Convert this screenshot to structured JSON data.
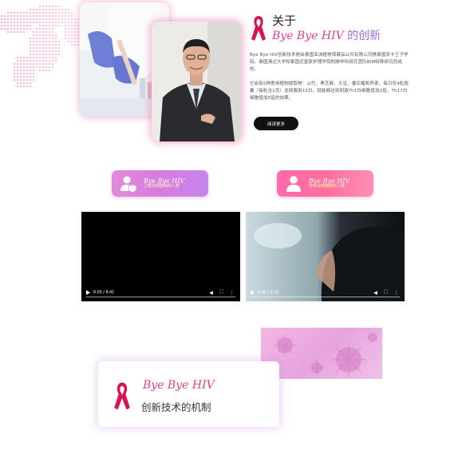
{
  "about": {
    "title_prefix": "关于",
    "brand": "Bye Bye HIV",
    "title_suffix": "的创新",
    "paragraph1": "Bye Bye HIV创新技术是由泰国亚洲植物保健品公共有限公司携泰国宋卡王子学院、泰国清迈大学和泰国迈皇家护理学院的跨学科研究团队BIM特殊研究而成的。",
    "paragraph2": "它会有5种食用植物提取物：山竹、黑芝麻、大豆、番石榴和异麦。每日仅4粒胶囊（每粒含2克）连续服用15日，就能够达到刺激Th1白细胞增加2倍、Th17白细胞增加5倍的效果。",
    "more_button": "阅读更多"
  },
  "roles": [
    {
      "title": "Bye Bye HIV",
      "subtitle": "上蚊状细胞病例人群",
      "color": "#d77be0"
    },
    {
      "title": "Bye Bye HIV",
      "subtitle": "未蚊状细胞病例人群",
      "color": "#ff6aa9"
    }
  ],
  "videos": [
    {
      "time": "0:00 / 6:41"
    },
    {
      "time": "0:00 / 5:29"
    }
  ],
  "mechanism": {
    "brand": "Bye Bye HIV",
    "subtitle": "创新技术的机制"
  },
  "colors": {
    "brand_pink": "#e23f86",
    "accent_purple": "#a070e0"
  },
  "icons": [
    "ribbon-icon",
    "user-shield-icon",
    "user-icon",
    "play-icon",
    "volume-icon",
    "fullscreen-icon",
    "more-icon"
  ]
}
